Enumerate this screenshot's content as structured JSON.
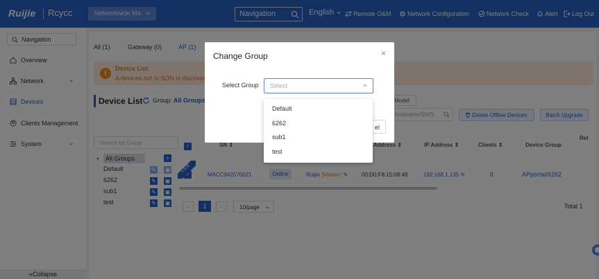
{
  "topbar": {
    "logo": "Ruijie",
    "logo2": "Rcycc",
    "network_select": "Networkwide Ma",
    "nav_search": "Navigation",
    "language": "English",
    "remote": "Remote O&M",
    "netconf": "Network Configuration",
    "netcheck": "Network Check",
    "alert": "Alert",
    "logout": "Log Out"
  },
  "sidebar": {
    "search": "Navigation",
    "items": [
      {
        "label": "Overview"
      },
      {
        "label": "Network"
      },
      {
        "label": "Devices"
      },
      {
        "label": "Clients Management"
      },
      {
        "label": "System"
      }
    ],
    "collapse": "Collapse"
  },
  "tabs": {
    "all": "All (1)",
    "gateway": "Gateway (0)",
    "ap": "AP (1)"
  },
  "banner": {
    "title": "Device List",
    "text": "A devices not in SON is discovere"
  },
  "devicelist": {
    "title": "Device List",
    "group_label": "Group:",
    "group_value": "All Groups",
    "model_btn": "Model",
    "search_placeholder": "hostname/SN/S",
    "delete_offline": "Delete Offline Devices",
    "batch_upgrade": "Batch Upgrade"
  },
  "groups": {
    "search_placeholder": "Search by Group",
    "all": "All Groups",
    "items": [
      "Default",
      "6262",
      "sub1",
      "test"
    ]
  },
  "table": {
    "headers": {
      "sn": "SN",
      "mac": "Address",
      "ip": "IP Address",
      "clients": "Clients",
      "devgroup": "Device Group",
      "rel": "Rel"
    },
    "row": {
      "badge": "Local",
      "sn": "MACC942570021",
      "status": "Online",
      "name": "Ruijie",
      "role": "[Master]",
      "mac": "00:D0:F8:15:08:48",
      "ip": "192.168.1.135",
      "clients": "0",
      "devgroup": "APportal/6262"
    }
  },
  "pager": {
    "page": "1",
    "per_page": "10/page",
    "total": "Total 1"
  },
  "modal": {
    "title": "Change Group",
    "label": "Select Group",
    "placeholder": "Select",
    "cancel_partial": "el",
    "options": [
      "Default",
      "6262",
      "sub1",
      "test"
    ]
  },
  "colors": {
    "primary": "#2462c4",
    "warning": "#f08b2a",
    "warning_bg": "#fde8d7"
  }
}
